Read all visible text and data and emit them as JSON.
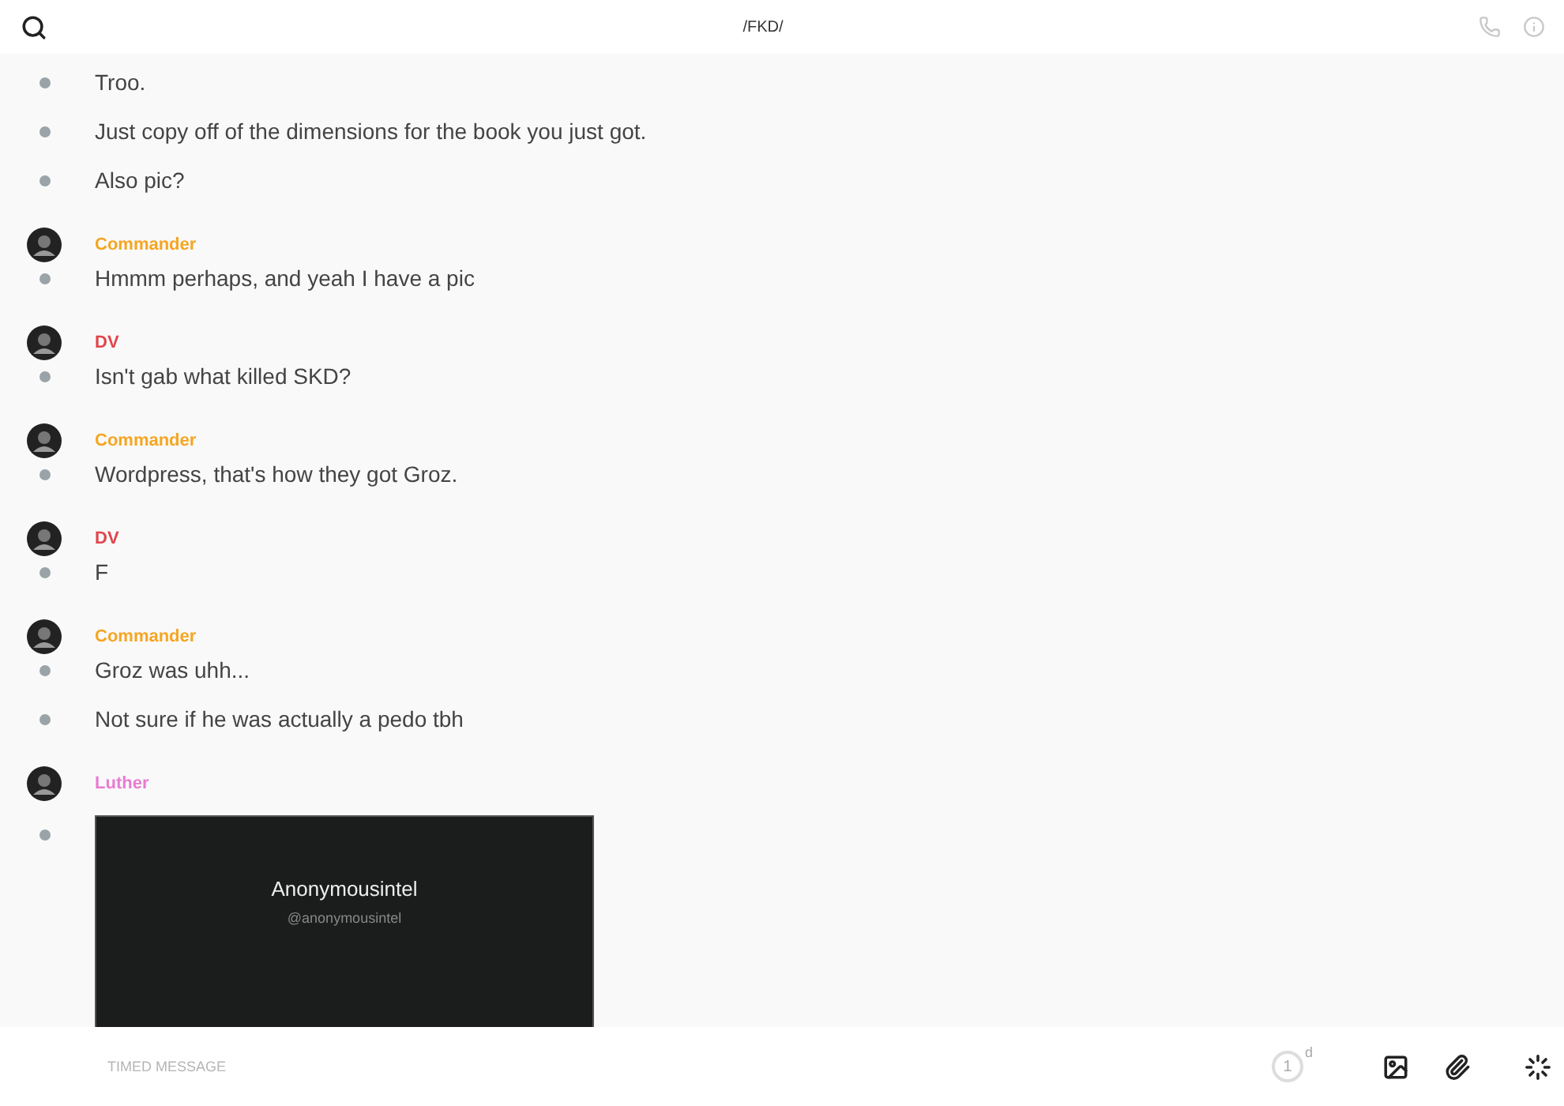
{
  "header": {
    "title": "/FKD/"
  },
  "groups": [
    {
      "messages": [
        {
          "kind": "text",
          "text": "Troo."
        },
        {
          "kind": "text",
          "text": "Just copy off of the dimensions for the book you just got."
        },
        {
          "kind": "text",
          "text": "Also pic?"
        }
      ]
    },
    {
      "author": "Commander",
      "color": "#f5a623",
      "messages": [
        {
          "kind": "text",
          "text": "Hmmm perhaps, and yeah I have a pic"
        }
      ]
    },
    {
      "author": "DV",
      "color": "#e0454b",
      "messages": [
        {
          "kind": "text",
          "text": "Isn't gab what killed SKD?"
        }
      ]
    },
    {
      "author": "Commander",
      "color": "#f5a623",
      "messages": [
        {
          "kind": "text",
          "text": "Wordpress, that's how they got Groz."
        }
      ]
    },
    {
      "author": "DV",
      "color": "#e0454b",
      "messages": [
        {
          "kind": "text",
          "text": "F"
        }
      ]
    },
    {
      "author": "Commander",
      "color": "#f5a623",
      "messages": [
        {
          "kind": "text",
          "text": "Groz was uhh..."
        },
        {
          "kind": "text",
          "text": "Not sure if he was actually a pedo tbh"
        }
      ]
    },
    {
      "author": "Luther",
      "color": "#e87bd2",
      "messages": [
        {
          "kind": "image",
          "title": "Anonymousintel",
          "handle": "@anonymousintel"
        }
      ]
    }
  ],
  "composer": {
    "placeholder": "TIMED MESSAGE",
    "timer": "1",
    "timer_unit": "d"
  }
}
